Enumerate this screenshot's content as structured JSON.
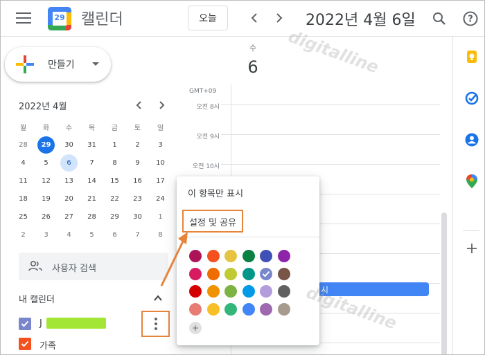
{
  "header": {
    "app_name": "캘린더",
    "logo_day": "29",
    "today_label": "오늘",
    "date_title": "2022년 4월 6일",
    "icons": [
      "menu-icon",
      "chevron-left-icon",
      "chevron-right-icon",
      "search-icon",
      "help-icon"
    ]
  },
  "create": {
    "label": "만들기"
  },
  "mini_calendar": {
    "title": "2022년 4월",
    "weekdays": [
      "월",
      "화",
      "수",
      "목",
      "금",
      "토",
      "일"
    ],
    "weeks": [
      [
        "28",
        "29",
        "30",
        "31",
        "1",
        "2",
        "3"
      ],
      [
        "4",
        "5",
        "6",
        "7",
        "8",
        "9",
        "10"
      ],
      [
        "11",
        "12",
        "13",
        "14",
        "15",
        "16",
        "17"
      ],
      [
        "18",
        "19",
        "20",
        "21",
        "22",
        "23",
        "24"
      ],
      [
        "25",
        "26",
        "27",
        "28",
        "29",
        "30",
        "1"
      ],
      [
        "2",
        "3",
        "4",
        "5",
        "6",
        "7",
        "8"
      ]
    ],
    "today": "29",
    "selected": "6"
  },
  "people_search": {
    "label": "사용자 검색"
  },
  "my_calendars": {
    "title": "내 캘린더",
    "items": [
      {
        "name": "J",
        "color": "#7986cb",
        "checked": true
      },
      {
        "name": "가족",
        "color": "#f4511e",
        "checked": true
      }
    ]
  },
  "day_view": {
    "weekday": "수",
    "day": "6",
    "timezone": "GMT+09",
    "times": [
      "오전 8시",
      "오전 9시",
      "오전 10시"
    ],
    "event_label": "시"
  },
  "popup": {
    "show_only": "이 항목만 표시",
    "settings": "설정 및 공유",
    "colors": [
      [
        "#ad1457",
        "#f4511e",
        "#e4c441",
        "#0b8043",
        "#3f51b5",
        "#8e24aa"
      ],
      [
        "#d81b60",
        "#ef6c00",
        "#c0ca33",
        "#009688",
        "#7986cb",
        "#795548"
      ],
      [
        "#d50000",
        "#f09300",
        "#7cb342",
        "#039be5",
        "#b39ddb",
        "#616161"
      ],
      [
        "#e67c73",
        "#f6bf26",
        "#33b679",
        "#4285f4",
        "#9e69af",
        "#a79b8e"
      ]
    ],
    "selected_color": "#7986cb",
    "add_color": "+"
  },
  "watermark": "digitalline"
}
